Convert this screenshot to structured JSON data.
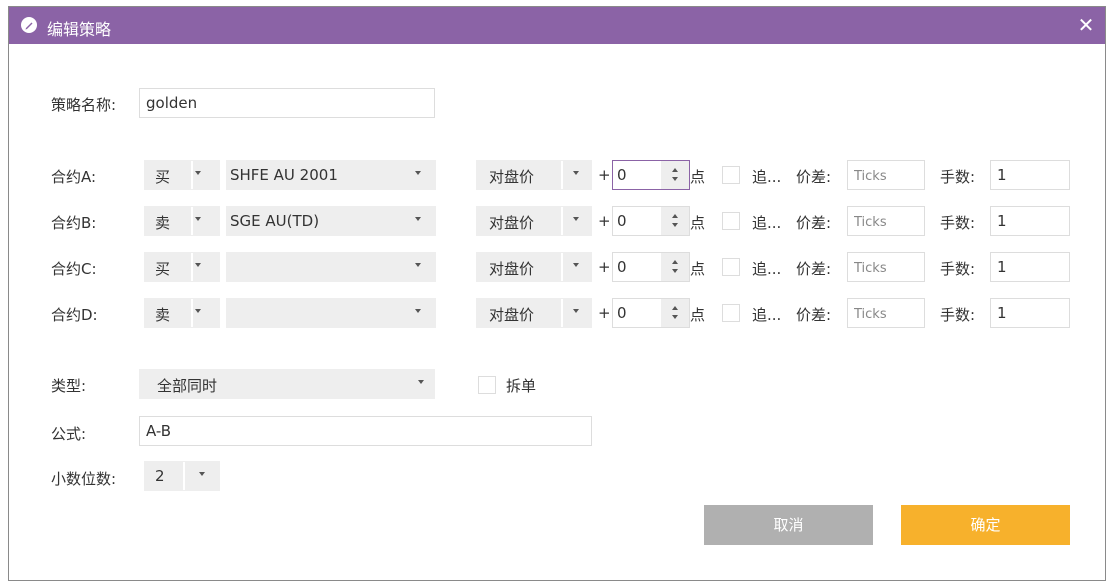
{
  "window": {
    "title": "编辑策略",
    "close_glyph": "✕"
  },
  "colors": {
    "titlebar": "#8b63a6",
    "cancel": "#b0b0b0",
    "confirm": "#f7b12c",
    "select_bg": "#eeeeee"
  },
  "form": {
    "name_label": "策略名称:",
    "name_value": "golden",
    "contracts": [
      {
        "label": "合约A:",
        "direction": "买",
        "instrument": "SHFE AU 2001",
        "price_type": "对盘价",
        "plus": "+",
        "offset": "0",
        "unit": "点",
        "chase": "追...",
        "spread_label": "价差:",
        "spread_placeholder": "Ticks",
        "qty_label": "手数:",
        "qty": "1"
      },
      {
        "label": "合约B:",
        "direction": "卖",
        "instrument": "SGE AU(TD)",
        "price_type": "对盘价",
        "plus": "+",
        "offset": "0",
        "unit": "点",
        "chase": "追...",
        "spread_label": "价差:",
        "spread_placeholder": "Ticks",
        "qty_label": "手数:",
        "qty": "1"
      },
      {
        "label": "合约C:",
        "direction": "买",
        "instrument": "",
        "price_type": "对盘价",
        "plus": "+",
        "offset": "0",
        "unit": "点",
        "chase": "追...",
        "spread_label": "价差:",
        "spread_placeholder": "Ticks",
        "qty_label": "手数:",
        "qty": "1"
      },
      {
        "label": "合约D:",
        "direction": "卖",
        "instrument": "",
        "price_type": "对盘价",
        "plus": "+",
        "offset": "0",
        "unit": "点",
        "chase": "追...",
        "spread_label": "价差:",
        "spread_placeholder": "Ticks",
        "qty_label": "手数:",
        "qty": "1"
      }
    ],
    "type_label": "类型:",
    "type_value": "全部同时",
    "split_label": "拆单",
    "formula_label": "公式:",
    "formula_value": "A-B",
    "decimals_label": "小数位数:",
    "decimals_value": "2"
  },
  "buttons": {
    "cancel": "取消",
    "confirm": "确定"
  }
}
